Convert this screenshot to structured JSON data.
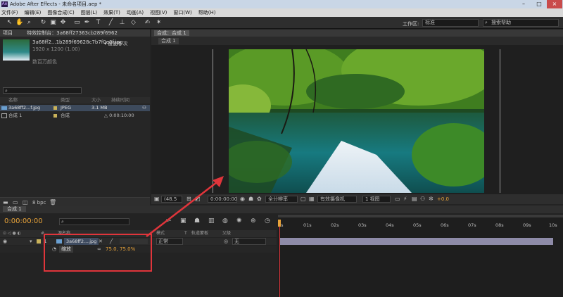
{
  "app": {
    "window_title": "Adobe After Effects - 未命名项目.aep *",
    "window_controls": [
      "–",
      "□",
      "×"
    ]
  },
  "menu": [
    "文件(F)",
    "编辑(E)",
    "图像合成(C)",
    "图层(L)",
    "效果(T)",
    "动画(A)",
    "视图(V)",
    "窗口(W)",
    "帮助(H)"
  ],
  "toolbar": {
    "workspace_label": "工作区:",
    "workspace_value": "标准",
    "search_placeholder": "搜索帮助"
  },
  "project_panel": {
    "tab_project": "项目",
    "tab_effects": "特效控制台：3a68ff27363cb289f6962",
    "asset_name": "3a68ff2...1b289f69628c7b7f0e0f.jpg",
    "asset_used": "▾ 被使用 次",
    "asset_dims": "1920 x 1200 (1.00)",
    "asset_color": "数百万颜色",
    "columns": [
      "名称",
      "类型",
      "大小",
      "持续时间"
    ],
    "items": [
      {
        "name": "3a68ff2...f.jpg",
        "type": "JPEG",
        "size": "3.1 MB",
        "duration": ""
      },
      {
        "name": "合成 1",
        "type": "合成",
        "size": "",
        "duration": "△ 0:00:10:00"
      }
    ],
    "bpc": "8 bpc"
  },
  "comp_panel": {
    "tab": "合成：合成 1",
    "breadcrumb": "合成 1",
    "zoom": "(48.5",
    "timecode": "0:00:00:00",
    "resolution": "全分辨率",
    "camera": "有效摄像机",
    "views": "1 视图",
    "exposure": "+0.0"
  },
  "timeline": {
    "tab": "合成 1",
    "current_time": "0:00:00:00",
    "columns": {
      "source": "源名称",
      "mode": "模式",
      "trkmat": "轨道蒙板",
      "parent": "父级"
    },
    "layer": {
      "index": "1",
      "name": "3a68ff2....jpg",
      "mode": "正常",
      "parent": "无"
    },
    "property": {
      "name": "缩放",
      "value": "75.0, 75.0%"
    },
    "ruler": [
      "01s",
      "02s",
      "03s",
      "04s",
      "05s",
      "06s",
      "07s",
      "08s",
      "09s",
      "10s"
    ],
    "ruler_start": "0s"
  },
  "colors": {
    "accent": "#e8a33a",
    "annotation": "#e0353b",
    "layer_bar": "#8e8ba8"
  }
}
